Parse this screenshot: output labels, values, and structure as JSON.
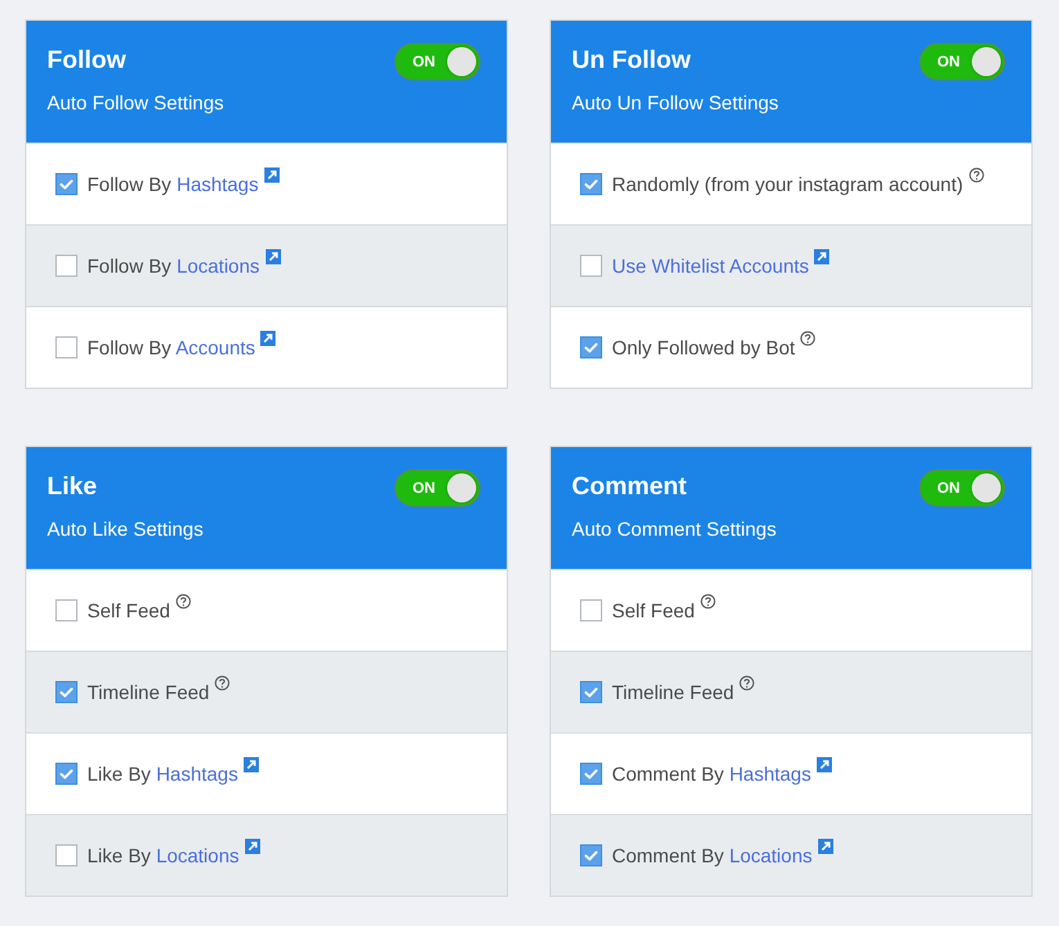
{
  "cards": [
    {
      "title": "Follow",
      "subtitle": "Auto Follow Settings",
      "toggle": {
        "label": "ON",
        "on": true
      },
      "options": [
        {
          "kind": "link",
          "checked": true,
          "text": "Follow By",
          "link": "Hashtags"
        },
        {
          "kind": "link",
          "checked": false,
          "text": "Follow By",
          "link": "Locations"
        },
        {
          "kind": "link",
          "checked": false,
          "text": "Follow By",
          "link": "Accounts"
        }
      ]
    },
    {
      "title": "Un Follow",
      "subtitle": "Auto Un Follow Settings",
      "toggle": {
        "label": "ON",
        "on": true
      },
      "options": [
        {
          "kind": "help",
          "checked": true,
          "text": "Randomly (from your instagram account)"
        },
        {
          "kind": "link",
          "checked": false,
          "link": "Use Whitelist Accounts"
        },
        {
          "kind": "help",
          "checked": true,
          "text": "Only Followed by Bot"
        }
      ]
    },
    {
      "title": "Like",
      "subtitle": "Auto Like Settings",
      "toggle": {
        "label": "ON",
        "on": true
      },
      "options": [
        {
          "kind": "help",
          "checked": false,
          "text": "Self Feed"
        },
        {
          "kind": "help",
          "checked": true,
          "text": "Timeline Feed"
        },
        {
          "kind": "link",
          "checked": true,
          "text": "Like By",
          "link": "Hashtags"
        },
        {
          "kind": "link",
          "checked": false,
          "text": "Like By",
          "link": "Locations"
        }
      ]
    },
    {
      "title": "Comment",
      "subtitle": "Auto Comment Settings",
      "toggle": {
        "label": "ON",
        "on": true
      },
      "options": [
        {
          "kind": "help",
          "checked": false,
          "text": "Self Feed"
        },
        {
          "kind": "help",
          "checked": true,
          "text": "Timeline Feed"
        },
        {
          "kind": "link",
          "checked": true,
          "text": "Comment By",
          "link": "Hashtags"
        },
        {
          "kind": "link",
          "checked": true,
          "text": "Comment By",
          "link": "Locations"
        }
      ]
    }
  ]
}
